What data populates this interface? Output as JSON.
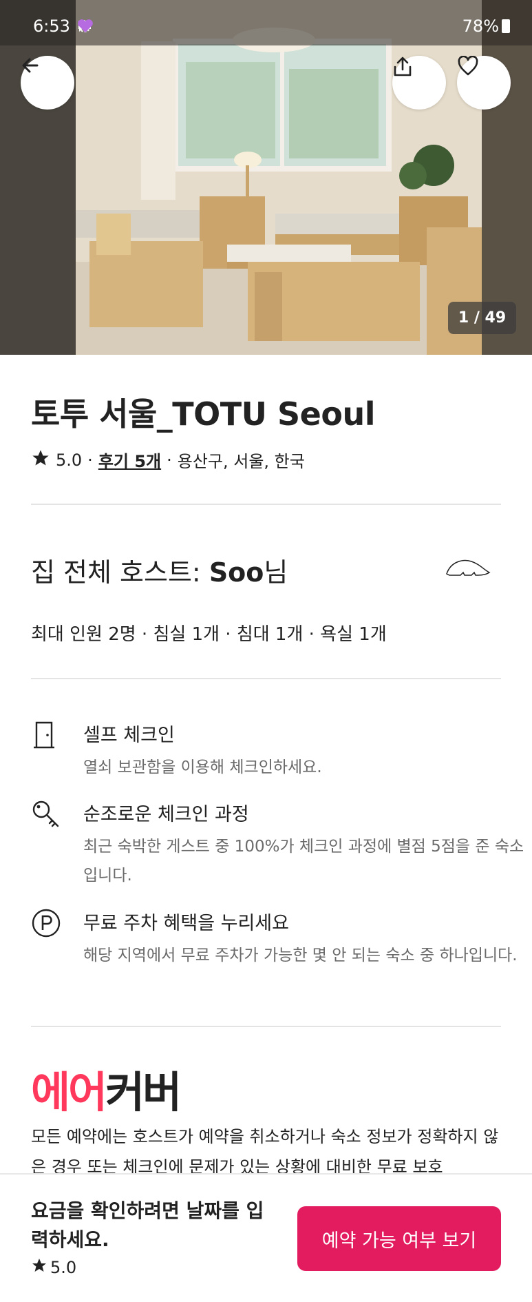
{
  "status_bar": {
    "time": "6:53",
    "battery": "78%",
    "icons": [
      "chat-bubble-icon",
      "sync-icon",
      "heart-icon"
    ],
    "heart_color": "#b66be0"
  },
  "hero": {
    "photo_counter": "1 / 49",
    "icons": {
      "back": "arrow-left-icon",
      "share": "share-icon",
      "favorite": "heart-outline-icon"
    }
  },
  "listing": {
    "title": "토투 서울_TOTU Seoul",
    "rating": "5.0",
    "reviews": "후기 5개",
    "separator": "·",
    "location": "용산구, 서울, 한국"
  },
  "host": {
    "title_prefix": "집 전체 호스트: ",
    "name": "Soo",
    "suffix": "님",
    "capacity": "최대 인원 2명 · 침실 1개 · 침대 1개 · 욕실 1개"
  },
  "features": [
    {
      "icon": "door-icon",
      "title": "셀프 체크인",
      "desc": "열쇠 보관함을 이용해 체크인하세요."
    },
    {
      "icon": "key-icon",
      "title": "순조로운 체크인 과정",
      "desc": "최근 숙박한 게스트 중 100%가 체크인 과정에 별점 5점을 준 숙소입니다."
    },
    {
      "icon": "parking-icon",
      "title": "무료 주차 혜택을 누리세요",
      "desc": "해당 지역에서 무료 주차가 가능한 몇 안 되는 숙소 중 하나입니다."
    }
  ],
  "aircover": {
    "logo_part1": "에어",
    "logo_part2": "커버",
    "text": "모든 예약에는 호스트가 예약을 취소하거나 숙소 정보가 정확하지 않은 경우 또는 체크인에 문제가 있는 상황에 대비한 무료 보호",
    "brand_color": "#ff385c"
  },
  "footer": {
    "prompt": "요금을 확인하려면 날짜를 입력하세요.",
    "rating": "5.0",
    "cta_label": "예약 가능 여부 보기",
    "cta_color": "#e31c5f"
  }
}
